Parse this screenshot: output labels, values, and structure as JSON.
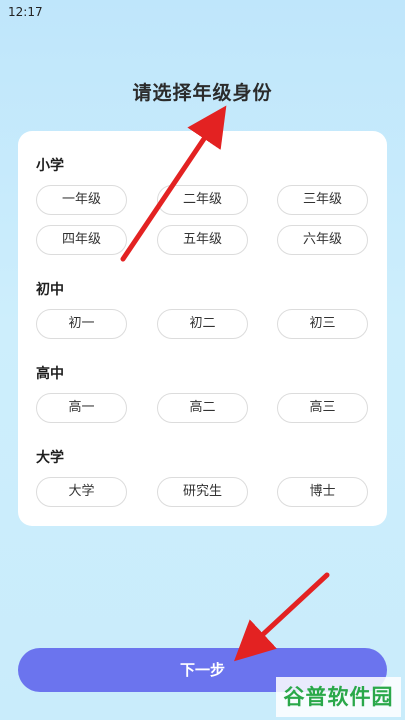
{
  "status_bar": {
    "time": "12:17"
  },
  "title": "请选择年级身份",
  "sections": [
    {
      "title": "小学",
      "items": [
        "一年级",
        "二年级",
        "三年级",
        "四年级",
        "五年级",
        "六年级"
      ]
    },
    {
      "title": "初中",
      "items": [
        "初一",
        "初二",
        "初三"
      ]
    },
    {
      "title": "高中",
      "items": [
        "高一",
        "高二",
        "高三"
      ]
    },
    {
      "title": "大学",
      "items": [
        "大学",
        "研究生",
        "博士"
      ]
    }
  ],
  "next_button": {
    "label": "下一步"
  },
  "watermark": {
    "text": "谷普软件园"
  },
  "colors": {
    "accent": "#6b74ee",
    "arrow": "#e32222",
    "watermark": "#2aa84a"
  },
  "icons": [
    "annotation-arrow-icon"
  ]
}
